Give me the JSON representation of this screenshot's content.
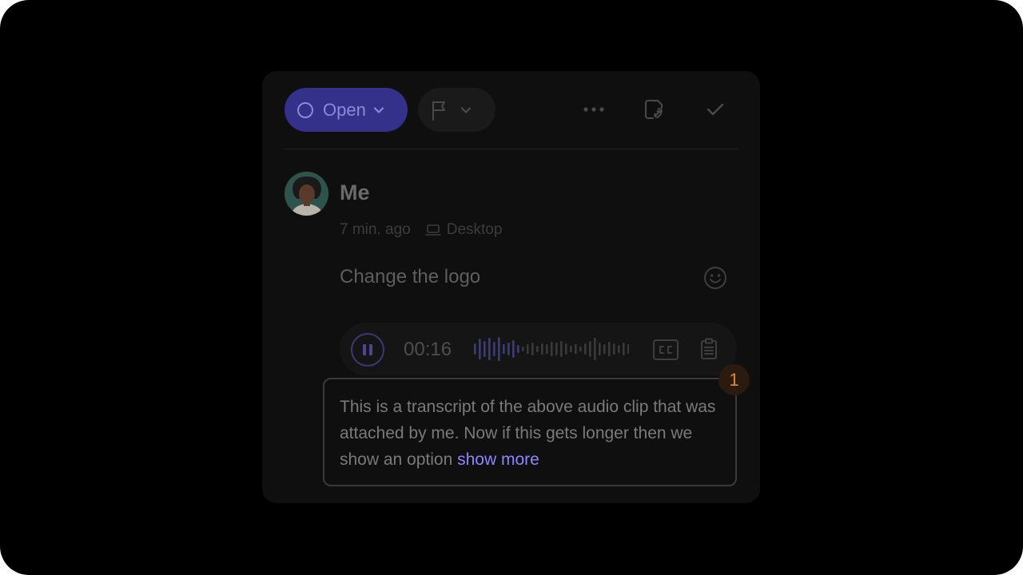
{
  "toolbar": {
    "status_label": "Open",
    "icons": [
      "circle-icon",
      "chevron-down-icon",
      "flag-icon",
      "more-icon",
      "link-document-icon",
      "checkmark-icon"
    ]
  },
  "comment": {
    "author": "Me",
    "time_ago": "7 min. ago",
    "device": "Desktop",
    "message": "Change the logo"
  },
  "audio": {
    "time": "00:16",
    "playing": true
  },
  "transcript": {
    "text": "This is a transcript of the above audio clip that was attached by me. Now if this gets longer then we show an option",
    "more_label": "show more",
    "badge": "1"
  },
  "colors": {
    "accent": "#33318a",
    "accent_text": "#8c8ad8",
    "link": "#8a87ff",
    "badge": "#e08a3a",
    "background": "#000000",
    "card": "#0f0f0f"
  }
}
